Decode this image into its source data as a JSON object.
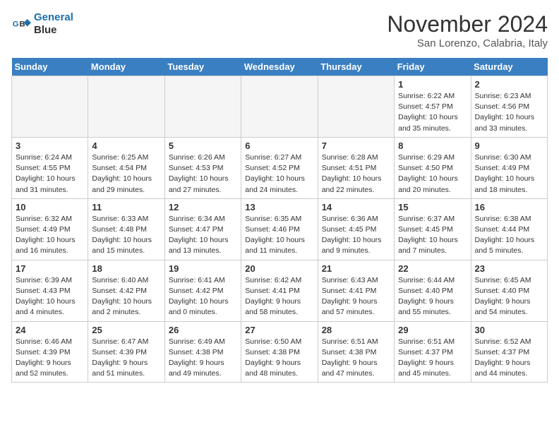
{
  "header": {
    "logo_line1": "General",
    "logo_line2": "Blue",
    "month": "November 2024",
    "location": "San Lorenzo, Calabria, Italy"
  },
  "days_of_week": [
    "Sunday",
    "Monday",
    "Tuesday",
    "Wednesday",
    "Thursday",
    "Friday",
    "Saturday"
  ],
  "weeks": [
    [
      {
        "day": "",
        "info": ""
      },
      {
        "day": "",
        "info": ""
      },
      {
        "day": "",
        "info": ""
      },
      {
        "day": "",
        "info": ""
      },
      {
        "day": "",
        "info": ""
      },
      {
        "day": "1",
        "info": "Sunrise: 6:22 AM\nSunset: 4:57 PM\nDaylight: 10 hours and 35 minutes."
      },
      {
        "day": "2",
        "info": "Sunrise: 6:23 AM\nSunset: 4:56 PM\nDaylight: 10 hours and 33 minutes."
      }
    ],
    [
      {
        "day": "3",
        "info": "Sunrise: 6:24 AM\nSunset: 4:55 PM\nDaylight: 10 hours and 31 minutes."
      },
      {
        "day": "4",
        "info": "Sunrise: 6:25 AM\nSunset: 4:54 PM\nDaylight: 10 hours and 29 minutes."
      },
      {
        "day": "5",
        "info": "Sunrise: 6:26 AM\nSunset: 4:53 PM\nDaylight: 10 hours and 27 minutes."
      },
      {
        "day": "6",
        "info": "Sunrise: 6:27 AM\nSunset: 4:52 PM\nDaylight: 10 hours and 24 minutes."
      },
      {
        "day": "7",
        "info": "Sunrise: 6:28 AM\nSunset: 4:51 PM\nDaylight: 10 hours and 22 minutes."
      },
      {
        "day": "8",
        "info": "Sunrise: 6:29 AM\nSunset: 4:50 PM\nDaylight: 10 hours and 20 minutes."
      },
      {
        "day": "9",
        "info": "Sunrise: 6:30 AM\nSunset: 4:49 PM\nDaylight: 10 hours and 18 minutes."
      }
    ],
    [
      {
        "day": "10",
        "info": "Sunrise: 6:32 AM\nSunset: 4:49 PM\nDaylight: 10 hours and 16 minutes."
      },
      {
        "day": "11",
        "info": "Sunrise: 6:33 AM\nSunset: 4:48 PM\nDaylight: 10 hours and 15 minutes."
      },
      {
        "day": "12",
        "info": "Sunrise: 6:34 AM\nSunset: 4:47 PM\nDaylight: 10 hours and 13 minutes."
      },
      {
        "day": "13",
        "info": "Sunrise: 6:35 AM\nSunset: 4:46 PM\nDaylight: 10 hours and 11 minutes."
      },
      {
        "day": "14",
        "info": "Sunrise: 6:36 AM\nSunset: 4:45 PM\nDaylight: 10 hours and 9 minutes."
      },
      {
        "day": "15",
        "info": "Sunrise: 6:37 AM\nSunset: 4:45 PM\nDaylight: 10 hours and 7 minutes."
      },
      {
        "day": "16",
        "info": "Sunrise: 6:38 AM\nSunset: 4:44 PM\nDaylight: 10 hours and 5 minutes."
      }
    ],
    [
      {
        "day": "17",
        "info": "Sunrise: 6:39 AM\nSunset: 4:43 PM\nDaylight: 10 hours and 4 minutes."
      },
      {
        "day": "18",
        "info": "Sunrise: 6:40 AM\nSunset: 4:42 PM\nDaylight: 10 hours and 2 minutes."
      },
      {
        "day": "19",
        "info": "Sunrise: 6:41 AM\nSunset: 4:42 PM\nDaylight: 10 hours and 0 minutes."
      },
      {
        "day": "20",
        "info": "Sunrise: 6:42 AM\nSunset: 4:41 PM\nDaylight: 9 hours and 58 minutes."
      },
      {
        "day": "21",
        "info": "Sunrise: 6:43 AM\nSunset: 4:41 PM\nDaylight: 9 hours and 57 minutes."
      },
      {
        "day": "22",
        "info": "Sunrise: 6:44 AM\nSunset: 4:40 PM\nDaylight: 9 hours and 55 minutes."
      },
      {
        "day": "23",
        "info": "Sunrise: 6:45 AM\nSunset: 4:40 PM\nDaylight: 9 hours and 54 minutes."
      }
    ],
    [
      {
        "day": "24",
        "info": "Sunrise: 6:46 AM\nSunset: 4:39 PM\nDaylight: 9 hours and 52 minutes."
      },
      {
        "day": "25",
        "info": "Sunrise: 6:47 AM\nSunset: 4:39 PM\nDaylight: 9 hours and 51 minutes."
      },
      {
        "day": "26",
        "info": "Sunrise: 6:49 AM\nSunset: 4:38 PM\nDaylight: 9 hours and 49 minutes."
      },
      {
        "day": "27",
        "info": "Sunrise: 6:50 AM\nSunset: 4:38 PM\nDaylight: 9 hours and 48 minutes."
      },
      {
        "day": "28",
        "info": "Sunrise: 6:51 AM\nSunset: 4:38 PM\nDaylight: 9 hours and 47 minutes."
      },
      {
        "day": "29",
        "info": "Sunrise: 6:51 AM\nSunset: 4:37 PM\nDaylight: 9 hours and 45 minutes."
      },
      {
        "day": "30",
        "info": "Sunrise: 6:52 AM\nSunset: 4:37 PM\nDaylight: 9 hours and 44 minutes."
      }
    ]
  ]
}
